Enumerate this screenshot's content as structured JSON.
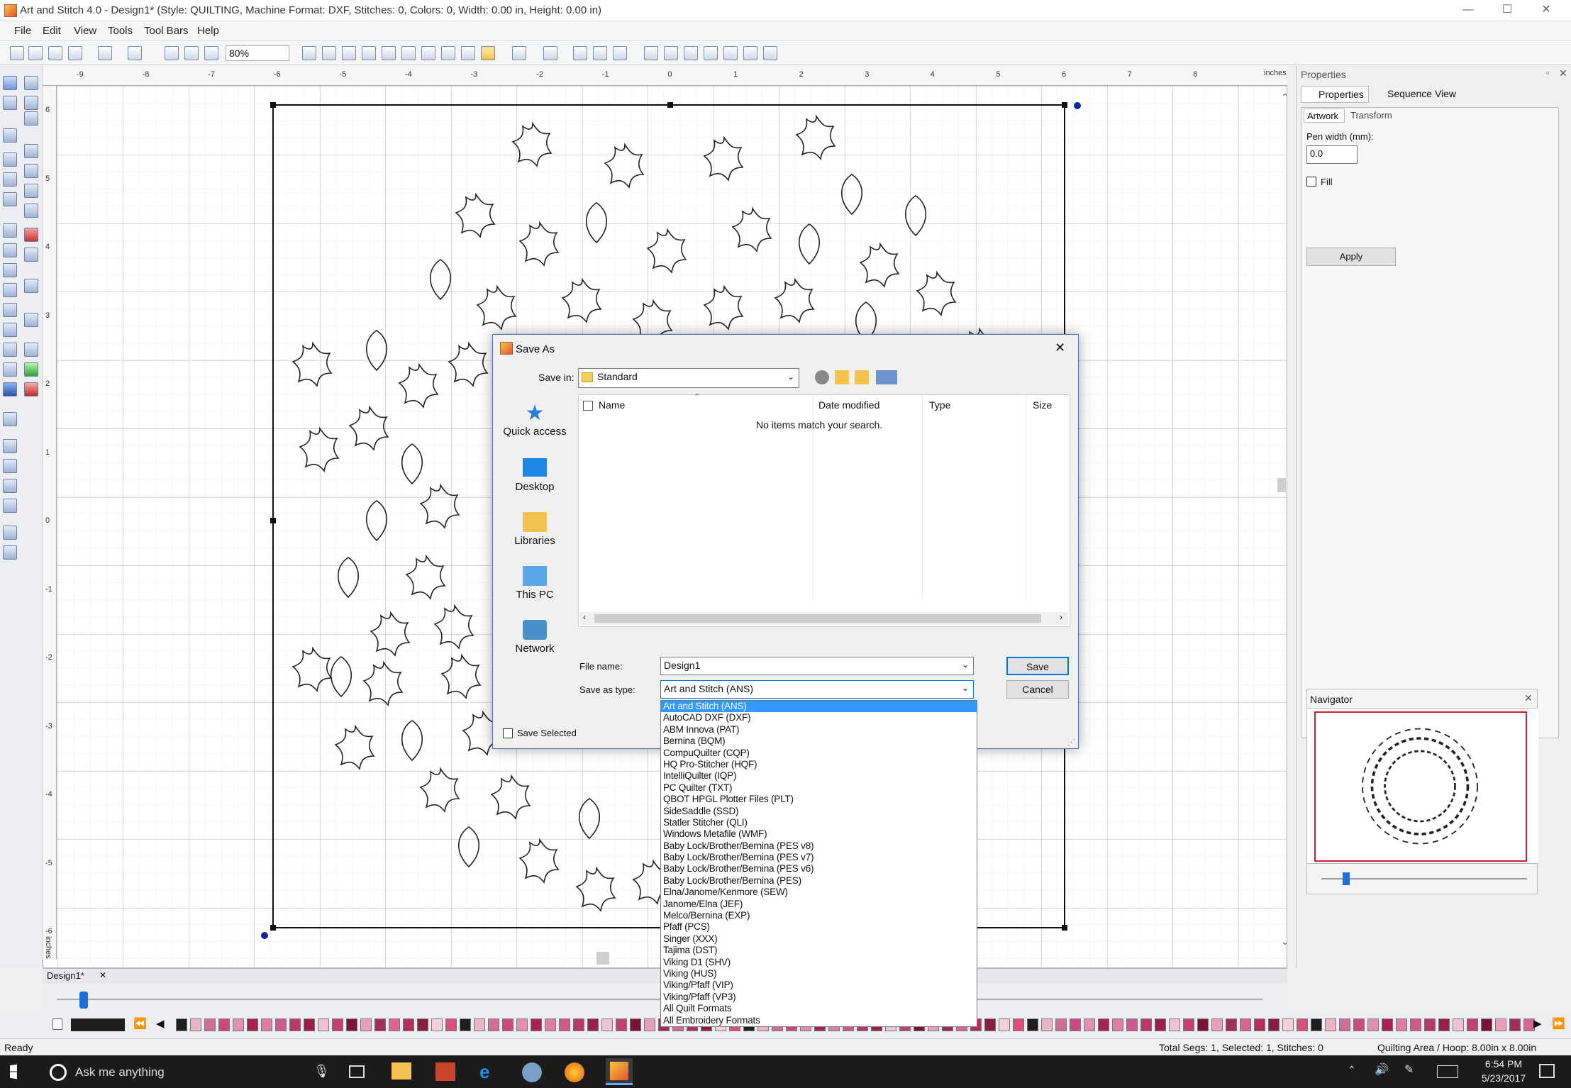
{
  "window": {
    "title": "Art and Stitch 4.0 - Design1* (Style: QUILTING, Machine Format: DXF, Stitches: 0, Colors: 0, Width: 0.00 in, Height: 0.00 in)",
    "minimize": "—",
    "maximize": "☐",
    "close": "✕"
  },
  "menu": [
    "File",
    "Edit",
    "View",
    "Tools",
    "Tool Bars",
    "Help"
  ],
  "toolbar": {
    "zoom": "80%"
  },
  "ruler": {
    "top_ticks": [
      "-9",
      "-8",
      "-7",
      "-6",
      "-5",
      "-4",
      "-3",
      "-2",
      "-1",
      "0",
      "1",
      "2",
      "3",
      "4",
      "5",
      "6",
      "7",
      "8"
    ],
    "left_ticks": [
      "6",
      "5",
      "4",
      "3",
      "2",
      "1",
      "0",
      "-1",
      "-2",
      "-3",
      "-4",
      "-5",
      "-6"
    ],
    "unit": "inches"
  },
  "dialog": {
    "title": "Save As",
    "close": "✕",
    "save_in_label": "Save in:",
    "save_in_value": "Standard",
    "places": [
      "Quick access",
      "Desktop",
      "Libraries",
      "This PC",
      "Network"
    ],
    "columns": [
      "Name",
      "Date modified",
      "Type",
      "Size"
    ],
    "empty_message": "No items match your search.",
    "file_name_label": "File name:",
    "file_name_value": "Design1",
    "save_type_label": "Save as type:",
    "save_type_value": "Art and Stitch (ANS)",
    "save_button": "Save",
    "cancel_button": "Cancel",
    "save_selected": "Save Selected",
    "type_options": [
      "Art and Stitch (ANS)",
      "AutoCAD DXF (DXF)",
      "ABM Innova (PAT)",
      "Bernina (BQM)",
      "CompuQuilter (CQP)",
      "HQ Pro-Stitcher (HQF)",
      "IntelliQuilter (IQP)",
      "PC Quilter (TXT)",
      "QBOT HPGL Plotter Files (PLT)",
      "SideSaddle (SSD)",
      "Statler Stitcher (QLI)",
      "Windows Metafile (WMF)",
      "Baby Lock/Brother/Bernina (PES v8)",
      "Baby Lock/Brother/Bernina (PES v7)",
      "Baby Lock/Brother/Bernina (PES v6)",
      "Baby Lock/Brother/Bernina (PES)",
      "Elna/Janome/Kenmore (SEW)",
      "Janome/Elna (JEF)",
      "Melco/Bernina (EXP)",
      "Pfaff (PCS)",
      "Singer (XXX)",
      "Tajima (DST)",
      "Viking D1 (SHV)",
      "Viking (HUS)",
      "Viking/Pfaff (VIP)",
      "Viking/Pfaff (VP3)",
      "All Quilt Formats",
      "All Embroidery Formats"
    ]
  },
  "properties_panel": {
    "title": "Properties",
    "tabs": [
      "Properties",
      "Sequence View"
    ],
    "subtabs": [
      "Artwork",
      "Transform"
    ],
    "pen_width_label": "Pen width (mm):",
    "pen_width_value": "0.0",
    "fill_label": "Fill",
    "apply_button": "Apply"
  },
  "navigator": {
    "title": "Navigator",
    "close": "✕"
  },
  "document_tab": {
    "label": "Design1*",
    "close": "✕"
  },
  "status": {
    "left": "Ready",
    "middle": "Total Segs: 1, Selected: 1, Stitches: 0",
    "right": "Quilting Area / Hoop: 8.00in x 8.00in"
  },
  "taskbar": {
    "search_placeholder": "Ask me anything",
    "time": "6:54 PM",
    "date": "5/23/2017"
  },
  "palette_colors": [
    "#1e1e1e",
    "#e8b4c6",
    "#d26e98",
    "#c84a7e",
    "#e38fb1",
    "#a8234f",
    "#de7ea3",
    "#cc5a8a",
    "#b9386a",
    "#982046",
    "#f0c1d2",
    "#c1426f",
    "#7a1432",
    "#e8a0b8",
    "#a0305a",
    "#d86690",
    "#b3305e",
    "#8a1e40",
    "#f3d0dc",
    "#d9507c"
  ]
}
